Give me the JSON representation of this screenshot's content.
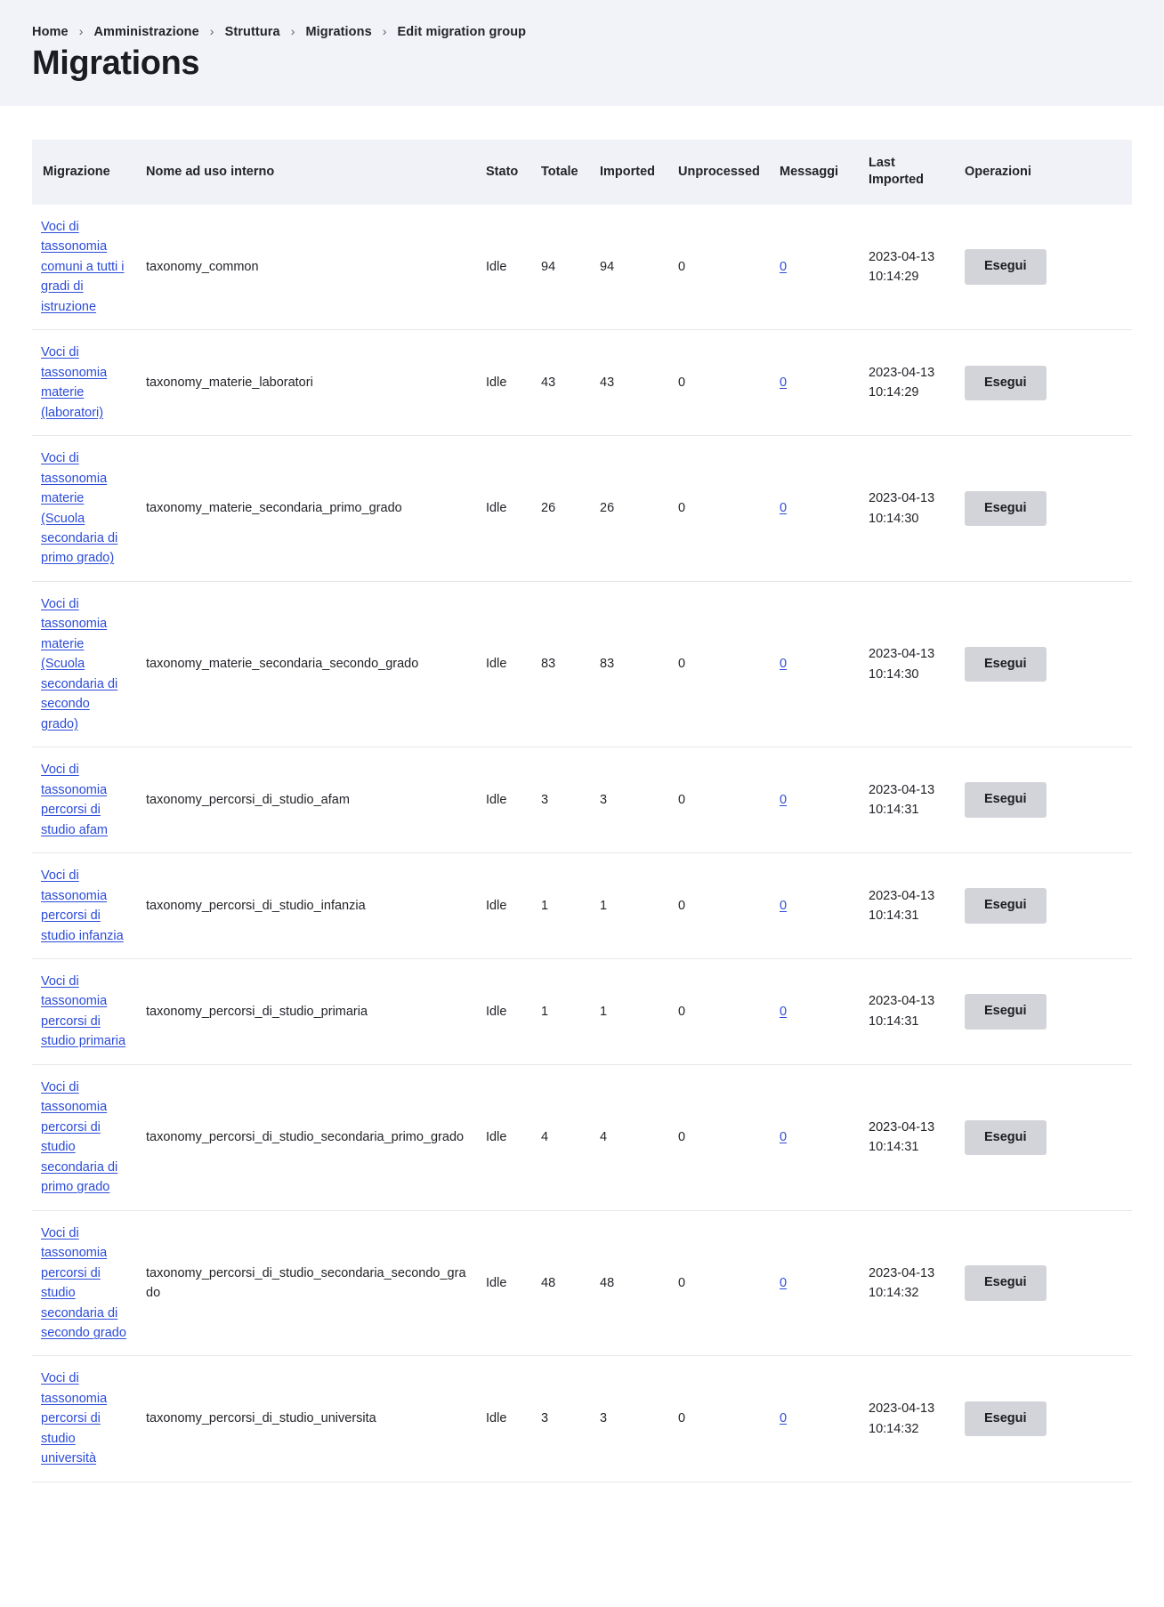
{
  "header": {
    "breadcrumb": [
      {
        "label": "Home"
      },
      {
        "label": "Amministrazione"
      },
      {
        "label": "Struttura"
      },
      {
        "label": "Migrations"
      },
      {
        "label": "Edit migration group"
      }
    ],
    "separator": "›",
    "title": "Migrations"
  },
  "table": {
    "columns": [
      {
        "key": "migrazione",
        "label": "Migrazione"
      },
      {
        "key": "nome",
        "label": "Nome ad uso interno"
      },
      {
        "key": "stato",
        "label": "Stato"
      },
      {
        "key": "totale",
        "label": "Totale"
      },
      {
        "key": "imported",
        "label": "Imported"
      },
      {
        "key": "unprocessed",
        "label": "Unprocessed"
      },
      {
        "key": "messaggi",
        "label": "Messaggi"
      },
      {
        "key": "last_imported",
        "label": "Last Imported"
      },
      {
        "key": "operazioni",
        "label": "Operazioni"
      }
    ],
    "action_label": "Esegui",
    "link_color": "#2b4bd8",
    "rows": [
      {
        "migrazione": "Voci di tassonomia comuni a tutti i gradi di istruzione",
        "nome": "taxonomy_common",
        "stato": "Idle",
        "totale": "94",
        "imported": "94",
        "unprocessed": "0",
        "messaggi": "0",
        "last_imported_date": "2023-04-13",
        "last_imported_time": "10:14:29",
        "operazioni": "Esegui"
      },
      {
        "migrazione": "Voci di tassonomia materie (laboratori)",
        "nome": "taxonomy_materie_laboratori",
        "stato": "Idle",
        "totale": "43",
        "imported": "43",
        "unprocessed": "0",
        "messaggi": "0",
        "last_imported_date": "2023-04-13",
        "last_imported_time": "10:14:29",
        "operazioni": "Esegui"
      },
      {
        "migrazione": "Voci di tassonomia materie (Scuola secondaria di primo grado)",
        "nome": "taxonomy_materie_secondaria_primo_grado",
        "stato": "Idle",
        "totale": "26",
        "imported": "26",
        "unprocessed": "0",
        "messaggi": "0",
        "last_imported_date": "2023-04-13",
        "last_imported_time": "10:14:30",
        "operazioni": "Esegui"
      },
      {
        "migrazione": "Voci di tassonomia materie (Scuola secondaria di secondo grado)",
        "nome": "taxonomy_materie_secondaria_secondo_grado",
        "stato": "Idle",
        "totale": "83",
        "imported": "83",
        "unprocessed": "0",
        "messaggi": "0",
        "last_imported_date": "2023-04-13",
        "last_imported_time": "10:14:30",
        "operazioni": "Esegui"
      },
      {
        "migrazione": "Voci di tassonomia percorsi di studio afam",
        "nome": "taxonomy_percorsi_di_studio_afam",
        "stato": "Idle",
        "totale": "3",
        "imported": "3",
        "unprocessed": "0",
        "messaggi": "0",
        "last_imported_date": "2023-04-13",
        "last_imported_time": "10:14:31",
        "operazioni": "Esegui"
      },
      {
        "migrazione": "Voci di tassonomia percorsi di studio infanzia",
        "nome": "taxonomy_percorsi_di_studio_infanzia",
        "stato": "Idle",
        "totale": "1",
        "imported": "1",
        "unprocessed": "0",
        "messaggi": "0",
        "last_imported_date": "2023-04-13",
        "last_imported_time": "10:14:31",
        "operazioni": "Esegui"
      },
      {
        "migrazione": "Voci di tassonomia percorsi di studio primaria",
        "nome": "taxonomy_percorsi_di_studio_primaria",
        "stato": "Idle",
        "totale": "1",
        "imported": "1",
        "unprocessed": "0",
        "messaggi": "0",
        "last_imported_date": "2023-04-13",
        "last_imported_time": "10:14:31",
        "operazioni": "Esegui"
      },
      {
        "migrazione": "Voci di tassonomia percorsi di studio secondaria di primo grado",
        "nome": "taxonomy_percorsi_di_studio_secondaria_primo_grado",
        "stato": "Idle",
        "totale": "4",
        "imported": "4",
        "unprocessed": "0",
        "messaggi": "0",
        "last_imported_date": "2023-04-13",
        "last_imported_time": "10:14:31",
        "operazioni": "Esegui"
      },
      {
        "migrazione": "Voci di tassonomia percorsi di studio secondaria di secondo grado",
        "nome": "taxonomy_percorsi_di_studio_secondaria_secondo_grado",
        "stato": "Idle",
        "totale": "48",
        "imported": "48",
        "unprocessed": "0",
        "messaggi": "0",
        "last_imported_date": "2023-04-13",
        "last_imported_time": "10:14:32",
        "operazioni": "Esegui"
      },
      {
        "migrazione": "Voci di tassonomia percorsi di studio università",
        "nome": "taxonomy_percorsi_di_studio_universita",
        "stato": "Idle",
        "totale": "3",
        "imported": "3",
        "unprocessed": "0",
        "messaggi": "0",
        "last_imported_date": "2023-04-13",
        "last_imported_time": "10:14:32",
        "operazioni": "Esegui"
      }
    ]
  }
}
